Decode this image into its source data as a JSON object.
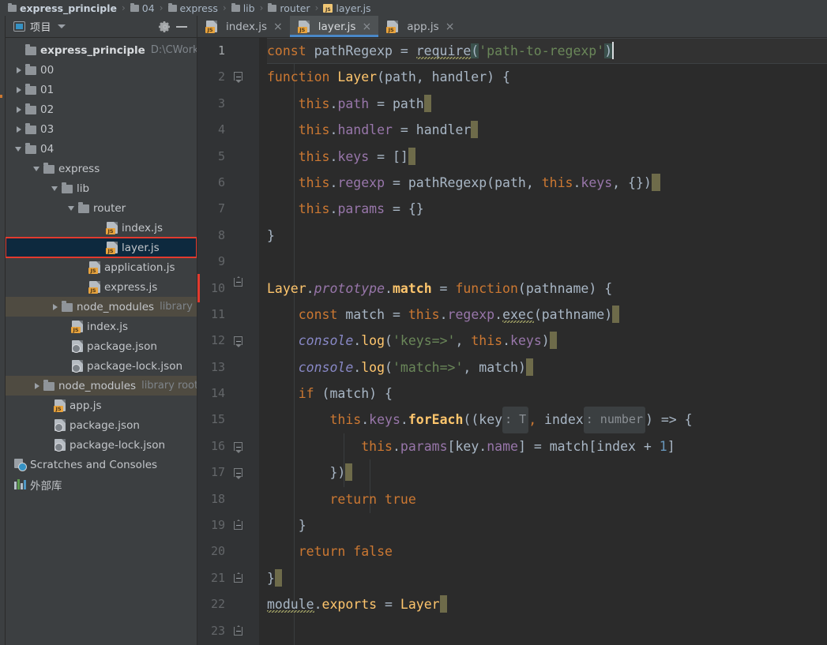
{
  "breadcrumb": {
    "items": [
      {
        "label": "express_principle",
        "icon": "folder-icon",
        "bold": true
      },
      {
        "label": "04",
        "icon": "folder-icon",
        "bold": false
      },
      {
        "label": "express",
        "icon": "folder-icon",
        "bold": false
      },
      {
        "label": "lib",
        "icon": "folder-icon",
        "bold": false
      },
      {
        "label": "router",
        "icon": "folder-icon",
        "bold": false
      },
      {
        "label": "layer.js",
        "icon": "js-file-icon",
        "bold": false
      }
    ],
    "separator": "›"
  },
  "project_panel": {
    "title": "项目",
    "window_icon": "project-window-icon",
    "dropdown_icon": "chevron-down-icon",
    "settings_icon": "gear-icon",
    "minimize_icon": "minimize-icon",
    "tree": [
      {
        "label": "express_principle",
        "sub": "D:\\CWork",
        "icon": "folder-icon",
        "indent": 1,
        "arrow": "open-hidden",
        "bold": true,
        "state": "normal"
      },
      {
        "label": "00",
        "sub": "",
        "icon": "folder-icon",
        "indent": 1,
        "arrow": "closed",
        "bold": false,
        "state": "normal"
      },
      {
        "label": "01",
        "sub": "",
        "icon": "folder-icon",
        "indent": 1,
        "arrow": "closed",
        "bold": false,
        "state": "normal"
      },
      {
        "label": "02",
        "sub": "",
        "icon": "folder-icon",
        "indent": 1,
        "arrow": "closed",
        "bold": false,
        "state": "normal"
      },
      {
        "label": "03",
        "sub": "",
        "icon": "folder-icon",
        "indent": 1,
        "arrow": "closed",
        "bold": false,
        "state": "normal"
      },
      {
        "label": "04",
        "sub": "",
        "icon": "folder-icon",
        "indent": 1,
        "arrow": "open",
        "bold": false,
        "state": "normal"
      },
      {
        "label": "express",
        "sub": "",
        "icon": "folder-icon",
        "indent": 2,
        "arrow": "open",
        "bold": false,
        "state": "normal"
      },
      {
        "label": "lib",
        "sub": "",
        "icon": "folder-icon",
        "indent": 3,
        "arrow": "open",
        "bold": false,
        "state": "normal"
      },
      {
        "label": "router",
        "sub": "",
        "icon": "folder-icon",
        "indent": 4,
        "arrow": "open",
        "bold": false,
        "state": "normal"
      },
      {
        "label": "index.js",
        "sub": "",
        "icon": "js-file-icon",
        "indent": 6,
        "arrow": "none",
        "bold": false,
        "state": "normal"
      },
      {
        "label": "layer.js",
        "sub": "",
        "icon": "js-file-icon",
        "indent": 6,
        "arrow": "none",
        "bold": false,
        "state": "selected-boxed"
      },
      {
        "label": "application.js",
        "sub": "",
        "icon": "js-file-icon",
        "indent": 5,
        "arrow": "none",
        "bold": false,
        "state": "normal"
      },
      {
        "label": "express.js",
        "sub": "",
        "icon": "js-file-icon",
        "indent": 5,
        "arrow": "none",
        "bold": false,
        "state": "normal"
      },
      {
        "label": "node_modules",
        "sub": "library root",
        "icon": "folder-icon",
        "indent": 3,
        "arrow": "closed",
        "bold": false,
        "state": "library"
      },
      {
        "label": "index.js",
        "sub": "",
        "icon": "js-file-icon",
        "indent": 4,
        "arrow": "none",
        "bold": false,
        "state": "normal"
      },
      {
        "label": "package.json",
        "sub": "",
        "icon": "json-file-icon",
        "indent": 4,
        "arrow": "none",
        "bold": false,
        "state": "normal"
      },
      {
        "label": "package-lock.json",
        "sub": "",
        "icon": "json-file-icon",
        "indent": 4,
        "arrow": "none",
        "bold": false,
        "state": "normal"
      },
      {
        "label": "node_modules",
        "sub": "library root",
        "icon": "folder-icon",
        "indent": 2,
        "arrow": "closed",
        "bold": false,
        "state": "library"
      },
      {
        "label": "app.js",
        "sub": "",
        "icon": "js-file-icon",
        "indent": 3,
        "arrow": "none",
        "bold": false,
        "state": "normal"
      },
      {
        "label": "package.json",
        "sub": "",
        "icon": "json-file-icon",
        "indent": 3,
        "arrow": "none",
        "bold": false,
        "state": "normal"
      },
      {
        "label": "package-lock.json",
        "sub": "",
        "icon": "json-file-icon",
        "indent": 3,
        "arrow": "none",
        "bold": false,
        "state": "normal"
      },
      {
        "label": "Scratches and Consoles",
        "sub": "",
        "icon": "scratches-icon",
        "indent": 1,
        "arrow": "none",
        "bold": false,
        "state": "normal"
      },
      {
        "label": "外部库",
        "sub": "",
        "icon": "external-libraries-icon",
        "indent": 1,
        "arrow": "none",
        "bold": false,
        "state": "normal"
      }
    ]
  },
  "editor_tabs": [
    {
      "label": "index.js",
      "icon": "js-file-icon",
      "active": false,
      "close_icon": "×"
    },
    {
      "label": "layer.js",
      "icon": "js-file-icon",
      "active": true,
      "close_icon": "×"
    },
    {
      "label": "app.js",
      "icon": "js-file-icon",
      "active": false,
      "close_icon": "×"
    }
  ],
  "editor": {
    "filename": "layer.js",
    "language": "JavaScript",
    "current_line": 1,
    "line_numbers": [
      "1",
      "2",
      "3",
      "4",
      "5",
      "6",
      "7",
      "8",
      "9",
      "10",
      "11",
      "12",
      "13",
      "14",
      "15",
      "16",
      "17",
      "18",
      "19",
      "20",
      "21",
      "22",
      "23"
    ],
    "lines_text": [
      "const pathRegexp = require('path-to-regexp')",
      "function Layer(path, handler) {",
      "    this.path = path",
      "    this.handler = handler",
      "    this.keys = []",
      "    this.regexp = pathRegexp(path, this.keys, {})",
      "    this.params = {}",
      "}",
      "",
      "Layer.prototype.match = function(pathname) {",
      "    const match = this.regexp.exec(pathname)",
      "    console.log('keys=>', this.keys)",
      "    console.log('match=>', match)",
      "    if (match) {",
      "        this.keys.forEach((key : T , index : number ) => {",
      "            this.params[key.name] = match[index + 1]",
      "        })",
      "        return true",
      "    }",
      "    return false",
      "}",
      "module.exports = Layer",
      ""
    ],
    "inlay_hints": [
      ": T",
      ": number"
    ]
  },
  "colors": {
    "editor_background": "#2b2b2b",
    "gutter_background": "#313335",
    "panel_background": "#3c3f41",
    "active_tab_background": "#4e5254",
    "active_tab_underline": "#4a88c7",
    "selection_background": "#0d293e",
    "library_row_background": "#4f4b41",
    "annotation_box": "#e23a2e",
    "keyword": "#cc7832",
    "function": "#ffc66d",
    "property": "#9876aa",
    "string": "#6a8759",
    "number": "#6897bb",
    "identifier": "#a9b7c6",
    "global": "#8888c6",
    "trailing_whitespace": "#6e6b4a"
  }
}
